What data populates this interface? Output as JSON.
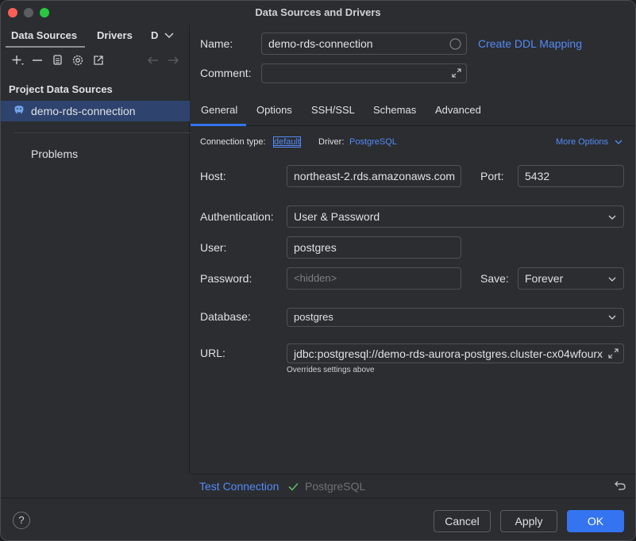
{
  "window": {
    "title": "Data Sources and Drivers"
  },
  "left": {
    "tabs": [
      {
        "label": "Data Sources"
      },
      {
        "label": "Drivers"
      },
      {
        "label": "D"
      }
    ],
    "section_title": "Project Data Sources",
    "datasource": {
      "label": "demo-rds-connection"
    },
    "problems_label": "Problems",
    "toolbar_icons": [
      "add-icon",
      "remove-icon",
      "copy-icon",
      "settings-icon",
      "open-external-icon",
      "back-arrow-icon",
      "forward-arrow-icon"
    ]
  },
  "form": {
    "name_label": "Name:",
    "name_value": "demo-rds-connection",
    "ddl_link": "Create DDL Mapping",
    "comment_label": "Comment:",
    "comment_value": "",
    "tabs": [
      {
        "label": "General"
      },
      {
        "label": "Options"
      },
      {
        "label": "SSH/SSL"
      },
      {
        "label": "Schemas"
      },
      {
        "label": "Advanced"
      }
    ],
    "connection_type_label": "Connection type:",
    "connection_type_value": "default",
    "driver_label": "Driver:",
    "driver_value": "PostgreSQL",
    "more_options": "More Options",
    "host_label": "Host:",
    "host_value": "northeast-2.rds.amazonaws.com",
    "port_label": "Port:",
    "port_value": "5432",
    "auth_label": "Authentication:",
    "auth_value": "User & Password",
    "user_label": "User:",
    "user_value": "postgres",
    "password_label": "Password:",
    "password_placeholder": "<hidden>",
    "save_label": "Save:",
    "save_value": "Forever",
    "database_label": "Database:",
    "database_value": "postgres",
    "url_label": "URL:",
    "url_value": "jdbc:postgresql://demo-rds-aurora-postgres.cluster-cx04wfourx",
    "url_hint": "Overrides settings above"
  },
  "status": {
    "test_connection": "Test Connection",
    "test_result": "PostgreSQL"
  },
  "footer": {
    "help": "?",
    "cancel": "Cancel",
    "apply": "Apply",
    "ok": "OK"
  },
  "colors": {
    "accent": "#3574f0",
    "link": "#548af7",
    "selection": "#2e436e",
    "success": "#5fb865"
  }
}
